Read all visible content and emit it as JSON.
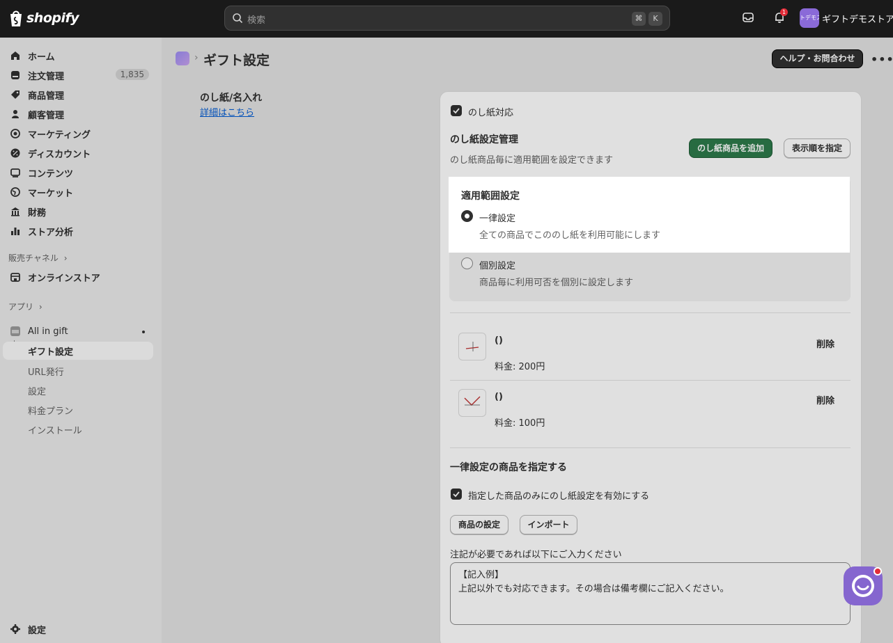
{
  "topbar": {
    "logo_text": "shopify",
    "search_placeholder": "検索",
    "kbd_cmd": "⌘",
    "kbd_k": "K",
    "notification_count": "1",
    "store_avatar_text": "トデモス",
    "store_name": "ギフトデモストア"
  },
  "sidebar": {
    "items": [
      {
        "label": "ホーム",
        "icon": "home-icon"
      },
      {
        "label": "注文管理",
        "icon": "orders-icon",
        "count": "1,835"
      },
      {
        "label": "商品管理",
        "icon": "tag-icon"
      },
      {
        "label": "顧客管理",
        "icon": "person-icon"
      },
      {
        "label": "マーケティング",
        "icon": "target-icon"
      },
      {
        "label": "ディスカウント",
        "icon": "discount-icon"
      },
      {
        "label": "コンテンツ",
        "icon": "content-icon"
      },
      {
        "label": "マーケット",
        "icon": "globe-icon"
      },
      {
        "label": "財務",
        "icon": "bank-icon"
      },
      {
        "label": "ストア分析",
        "icon": "chart-icon"
      }
    ],
    "sales_channels_label": "販売チャネル",
    "online_store_label": "オンラインストア",
    "apps_label": "アプリ",
    "app_name": "All in gift",
    "app_sub": [
      "ギフト設定",
      "URL発行",
      "設定",
      "料金プラン",
      "インストール"
    ],
    "settings_label": "設定"
  },
  "header": {
    "title": "ギフト設定",
    "help_button": "ヘルプ・お問合わせ",
    "more": "•••"
  },
  "section": {
    "title": "のし紙/名入れ",
    "link": "詳細はこちら"
  },
  "card": {
    "noshi_checkbox_label": "のし紙対応",
    "manage_title": "のし紙設定管理",
    "manage_desc": "のし紙商品毎に適用範囲を設定できます",
    "add_button": "のし紙商品を追加",
    "order_button": "表示順を指定",
    "scope_title": "適用範囲設定",
    "radio_uniform_label": "一律設定",
    "radio_uniform_desc": "全ての商品でこののし紙を利用可能にします",
    "radio_individual_label": "個別設定",
    "radio_individual_desc": "商品毎に利用可否を個別に設定します",
    "products": [
      {
        "name": "()",
        "price": "料金: 200円",
        "delete": "削除"
      },
      {
        "name": "()",
        "price": "料金: 100円",
        "delete": "削除"
      }
    ],
    "uniform_title": "一律設定の商品を指定する",
    "limit_checkbox_label": "指定した商品のみにのし紙設定を有効にする",
    "product_settings_button": "商品の設定",
    "import_button": "インポート",
    "note_label": "注記が必要であれば以下にご入力ください",
    "note_line1": "【記入例】",
    "note_line2": "上記以外でも対応できます。その場合は備考欄にご記入ください。"
  }
}
